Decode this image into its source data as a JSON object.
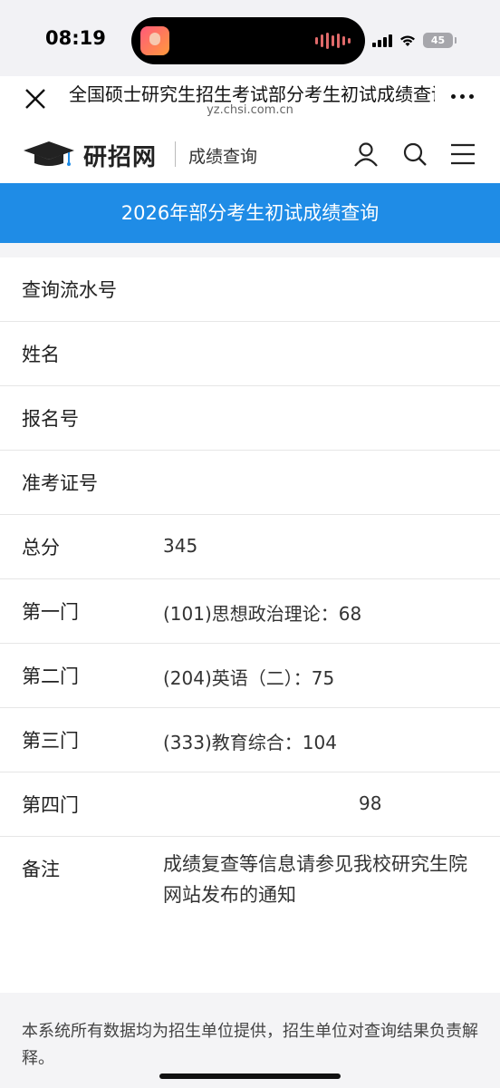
{
  "status_bar": {
    "time": "08:19",
    "battery": "45"
  },
  "browser": {
    "title": "全国硕士研究生招生考试部分考生初试成绩查询",
    "url": "yz.chsi.com.cn"
  },
  "site": {
    "logo_text": "研招网",
    "section": "成绩查询"
  },
  "banner": {
    "title": "2026年部分考生初试成绩查询"
  },
  "results": [
    {
      "label": "查询流水号",
      "value": ""
    },
    {
      "label": "姓名",
      "value": ""
    },
    {
      "label": "报名号",
      "value": ""
    },
    {
      "label": "准考证号",
      "value": ""
    },
    {
      "label": "总分",
      "value": "345"
    },
    {
      "label": "第一门",
      "value": "(101)思想政治理论：68"
    },
    {
      "label": "第二门",
      "value": "(204)英语（二）：75"
    },
    {
      "label": "第三门",
      "value": "(333)教育综合：104"
    },
    {
      "label": "第四门",
      "value": "98"
    }
  ],
  "note": {
    "label": "备注",
    "value": "成绩复查等信息请参见我校研究生院网站发布的通知"
  },
  "footer": {
    "text": "本系统所有数据均为招生单位提供，招生单位对查询结果负责解释。"
  },
  "colors": {
    "banner_bg": "#1f8ce6"
  }
}
